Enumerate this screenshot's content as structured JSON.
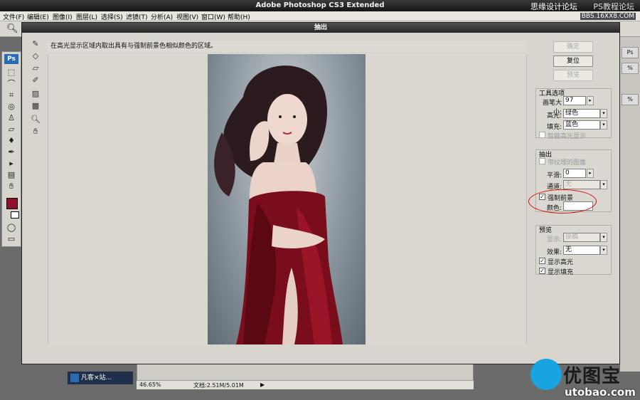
{
  "app": {
    "title": "Adobe Photoshop CS3 Extended",
    "watermark_left": "思缘设计论坛",
    "watermark_right": "PS教程论坛",
    "watermark_url": "BBS.16XX8.COM"
  },
  "menu": [
    "文件(F)",
    "编辑(E)",
    "图像(I)",
    "图层(L)",
    "选择(S)",
    "滤镜(T)",
    "分析(A)",
    "视图(V)",
    "窗口(W)",
    "帮助(H)"
  ],
  "dialog": {
    "title": "抽出",
    "instruction": "在高光显示区域内取出具有与强制前景色相似颜色的区域。",
    "buttons": {
      "ok": "确定",
      "reset": "复位",
      "preview": "预览"
    },
    "tool_options": {
      "title": "工具选项",
      "brush_size_label": "画笔大小:",
      "brush_size_value": "97",
      "highlight_label": "高光:",
      "highlight_value": "绿色",
      "fill_label": "填充:",
      "fill_value": "蓝色",
      "smart_highlight": "智能高光显示"
    },
    "extraction": {
      "title": "抽出",
      "textured_image": "带纹理的图像",
      "smooth_label": "平滑:",
      "smooth_value": "0",
      "channel_label": "通道:",
      "channel_value": "无",
      "force_fg_label": "强制前景",
      "force_fg_checked": true,
      "color_label": "颜色:",
      "color_value": "#ffffff"
    },
    "preview": {
      "title": "预览",
      "show_label": "显示:",
      "show_value": "原稿",
      "effect_label": "效果:",
      "effect_value": "无",
      "show_highlight": "显示高光",
      "show_fill": "显示填充",
      "show_highlight_checked": true,
      "show_fill_checked": true
    }
  },
  "status": {
    "zoom": "46.65%",
    "doc": "文档:2.51M/5.01M"
  },
  "taskbar": {
    "item": "凡客×站..."
  },
  "brand": {
    "name": "优图宝",
    "url": "utobao.com"
  },
  "colors": {
    "foreground": "#8f1033",
    "accent": "#19a3e1",
    "annotation": "#d01010"
  }
}
